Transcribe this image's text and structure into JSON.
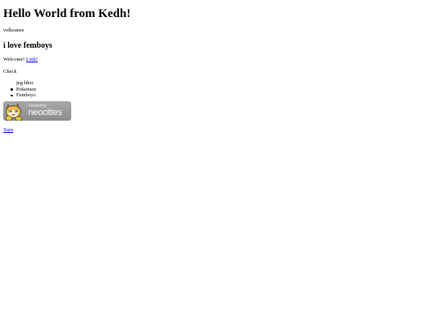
{
  "heading": "Hello World from Kedh!",
  "velkomen": "velkomen",
  "subheading": "i love femboys",
  "welcome": {
    "text": "Welcome! ",
    "link": "Link!"
  },
  "check": "Check",
  "list": [
    {
      "label": "jeg liker",
      "bulleted": false
    },
    {
      "label": "Pokemon",
      "bulleted": true
    },
    {
      "label": "Femboys",
      "bulleted": true
    }
  ],
  "badge": {
    "hosted_by": "hosted by",
    "name": "neocities",
    "mascot": "cat-mascot-icon"
  },
  "yarn_link": "Yarn",
  "colors": {
    "link": "#0000ee",
    "badge_bg": "#9a9a9a",
    "mascot_orange": "#f0a020"
  }
}
